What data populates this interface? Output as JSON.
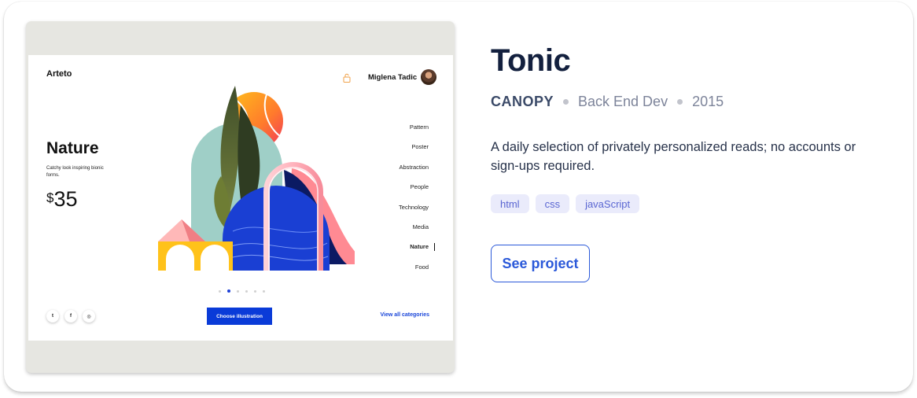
{
  "preview": {
    "brand": "Arteto",
    "user_name": "Miglena Tadic",
    "product_title": "Nature",
    "product_desc": "Catchy look inspiring bionic forms.",
    "currency": "$",
    "price": "35",
    "categories": [
      "Pattern",
      "Poster",
      "Abstraction",
      "People",
      "Technology",
      "Media",
      "Nature",
      "Food"
    ],
    "active_category": "Nature",
    "social": [
      {
        "icon": "twitter-icon",
        "glyph": "t"
      },
      {
        "icon": "facebook-icon",
        "glyph": "f"
      },
      {
        "icon": "instagram-icon",
        "glyph": "◎"
      }
    ],
    "choose_label": "Choose illustration",
    "view_all_label": "View all categories",
    "carousel": {
      "count": 6,
      "active": 1
    }
  },
  "project": {
    "name": "Tonic",
    "company": "CANOPY",
    "role": "Back End Dev",
    "year": "2015",
    "description": "A daily selection of privately personalized reads; no accounts or sign-ups required.",
    "tags": [
      "html",
      "css",
      "javaScript"
    ],
    "cta": "See project"
  },
  "colors": {
    "accent": "#2b59d9",
    "heading": "#13203e",
    "tag_bg": "#eaebfb",
    "tag_text": "#5a66d2",
    "mock_button": "#0a3bd8"
  }
}
